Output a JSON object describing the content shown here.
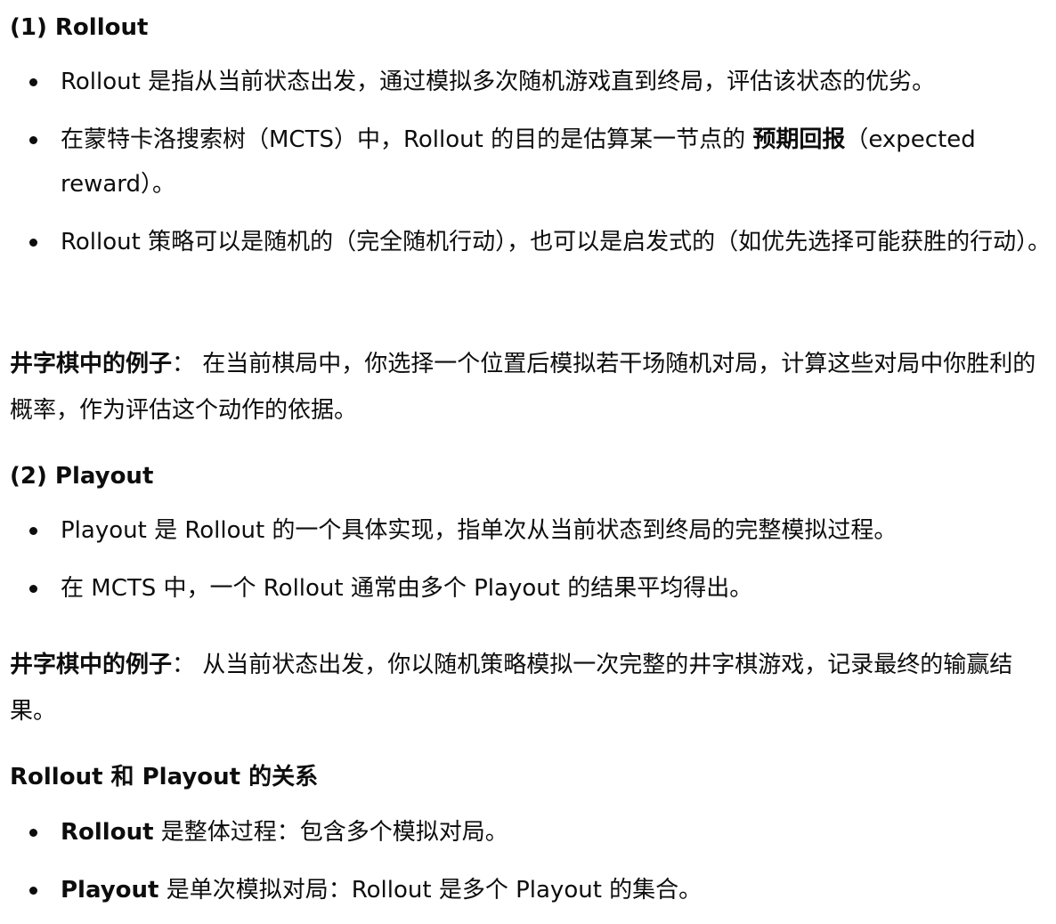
{
  "section1": {
    "heading": "(1) Rollout",
    "items": [
      {
        "text": "Rollout 是指从当前状态出发，通过模拟多次随机游戏直到终局，评估该状态的优劣。"
      },
      {
        "pre": "在蒙特卡洛搜索树（MCTS）中，Rollout 的目的是估算某一节点的 ",
        "bold": "预期回报",
        "post": "（expected reward）。"
      },
      {
        "text": "Rollout 策略可以是随机的（完全随机行动），也可以是启发式的（如优先选择可能获胜的行动）。"
      }
    ],
    "example_label": "井字棋中的例子",
    "example_colon": "：",
    "example_text": " 在当前棋局中，你选择一个位置后模拟若干场随机对局，计算这些对局中你胜利的概率，作为评估这个动作的依据。"
  },
  "section2": {
    "heading": "(2) Playout",
    "items": [
      {
        "text": "Playout 是 Rollout 的一个具体实现，指单次从当前状态到终局的完整模拟过程。"
      },
      {
        "text": "在 MCTS 中，一个 Rollout 通常由多个 Playout 的结果平均得出。"
      }
    ],
    "example_label": "井字棋中的例子",
    "example_colon": "：",
    "example_text": " 从当前状态出发，你以随机策略模拟一次完整的井字棋游戏，记录最终的输赢结果。"
  },
  "section3": {
    "heading": "Rollout 和 Playout 的关系",
    "items": [
      {
        "bold": "Rollout",
        "post": " 是整体过程：包含多个模拟对局。"
      },
      {
        "bold": "Playout",
        "post": " 是单次模拟对局：Rollout 是多个 Playout 的集合。"
      }
    ]
  }
}
